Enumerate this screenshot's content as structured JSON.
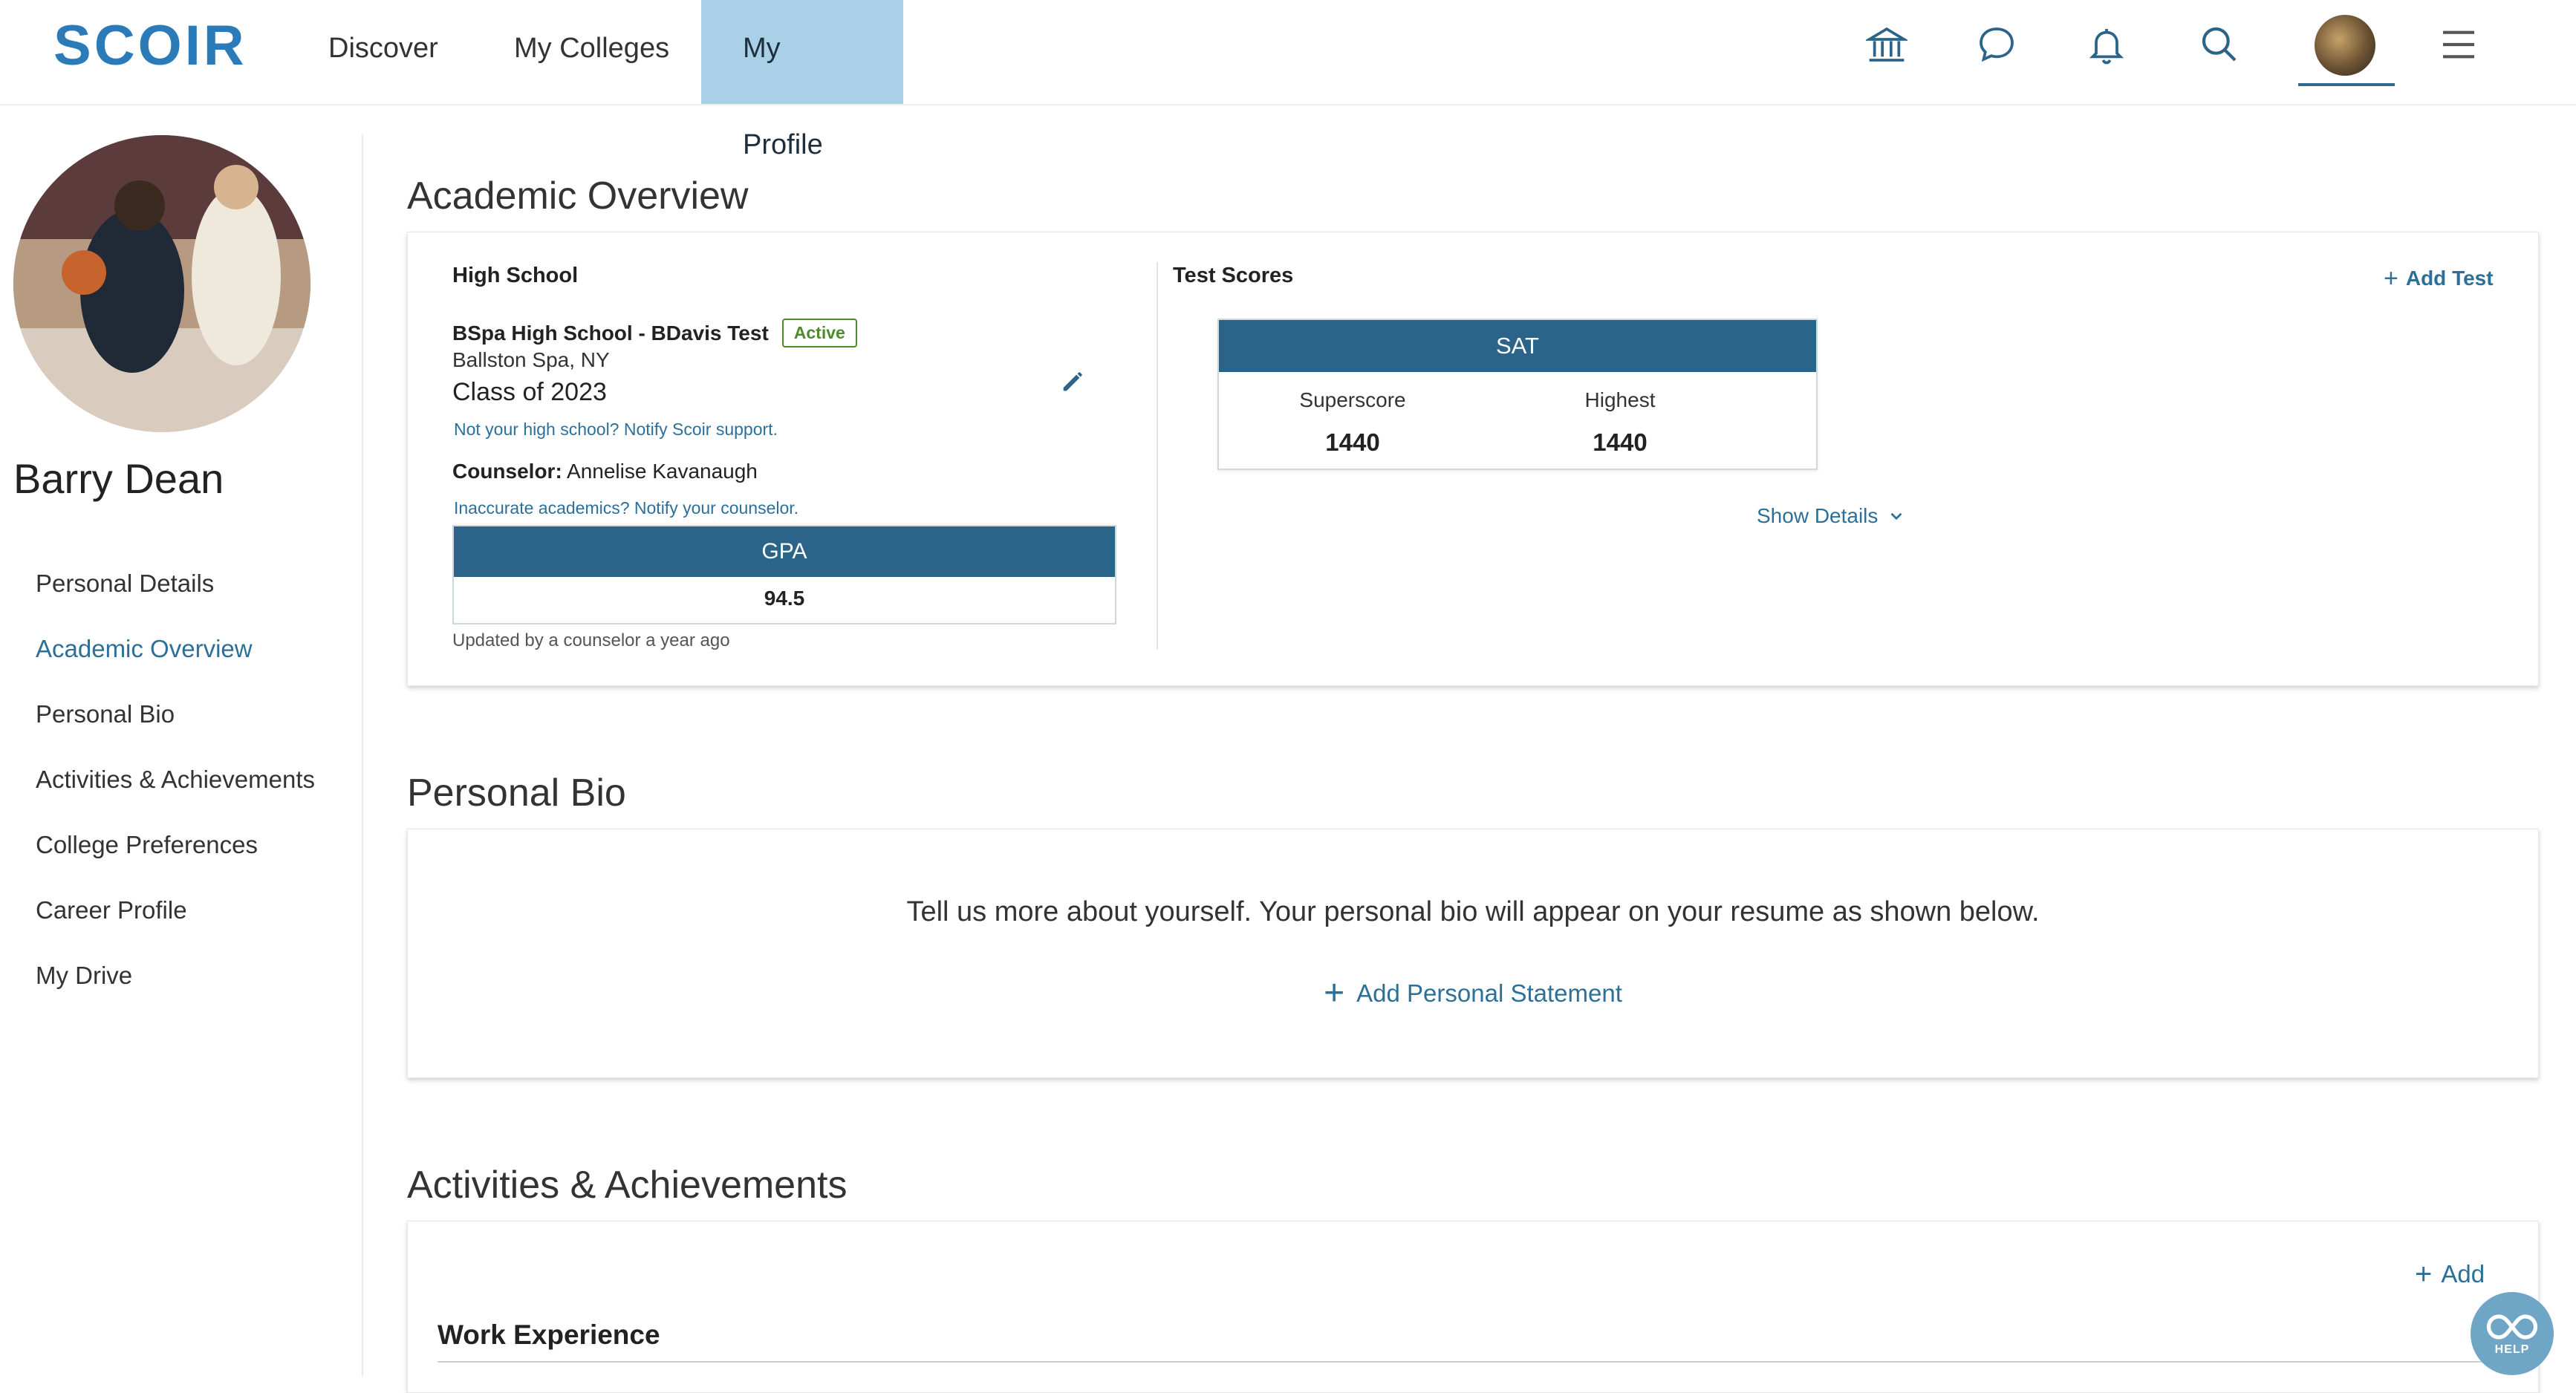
{
  "header": {
    "logo": "SCOIR",
    "nav": [
      "Discover",
      "My Colleges",
      "My Profile"
    ],
    "active_nav": "My Profile",
    "icons": [
      "institution-icon",
      "chat-icon",
      "bell-icon",
      "search-icon",
      "avatar",
      "menu-icon"
    ]
  },
  "sidebar": {
    "name": "Barry Dean",
    "items": [
      {
        "label": "Personal Details"
      },
      {
        "label": "Academic Overview"
      },
      {
        "label": "Personal Bio"
      },
      {
        "label": "Activities & Achievements"
      },
      {
        "label": "College Preferences"
      },
      {
        "label": "Career Profile"
      },
      {
        "label": "My Drive"
      }
    ],
    "active_item": "Academic Overview"
  },
  "academic": {
    "title": "Academic Overview",
    "high_school_heading": "High School",
    "school_name": "BSpa High School - BDavis Test",
    "status": "Active",
    "location": "Ballston Spa, NY",
    "class_of": "Class of 2023",
    "notify_link": "Not your high school? Notify Scoir support.",
    "counselor_label": "Counselor:",
    "counselor_name": "Annelise Kavanaugh",
    "inaccurate_link": "Inaccurate academics? Notify your counselor.",
    "gpa_label": "GPA",
    "gpa_value": "94.5",
    "updated": "Updated by a counselor a year ago",
    "test_scores_heading": "Test Scores",
    "add_test": "Add Test",
    "sat_label": "SAT",
    "superscore_label": "Superscore",
    "superscore_value": "1440",
    "highest_label": "Highest",
    "highest_value": "1440",
    "show_details": "Show Details"
  },
  "bio": {
    "title": "Personal Bio",
    "prompt": "Tell us more about yourself. Your personal bio will appear on your resume as shown below.",
    "add_statement": "Add Personal Statement"
  },
  "activities": {
    "title": "Activities & Achievements",
    "add": "Add",
    "work_experience": "Work Experience"
  },
  "help": {
    "label": "HELP"
  },
  "colors": {
    "brand_blue": "#2b7bb9",
    "nav_active_bg": "#a9d0e7",
    "link": "#2c6f99",
    "header_bar": "#2c6489",
    "active_green": "#4c8c2b"
  }
}
